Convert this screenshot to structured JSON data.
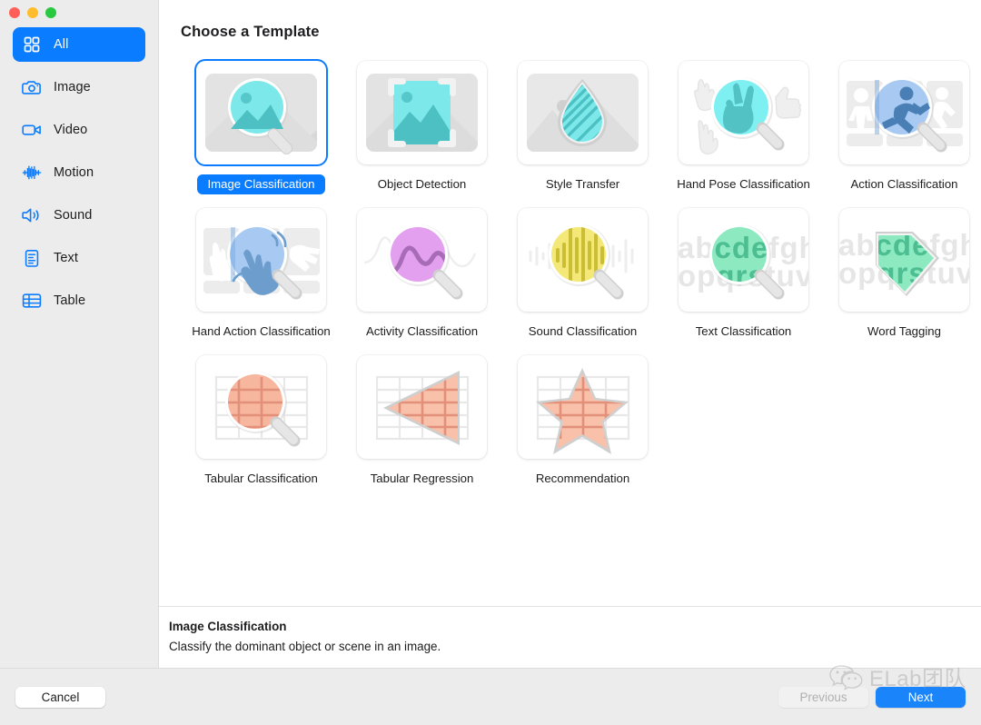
{
  "window": {
    "traffic_lights": [
      {
        "name": "close",
        "color": "#ff5f57"
      },
      {
        "name": "minimize",
        "color": "#febc2e"
      },
      {
        "name": "zoom",
        "color": "#28c840"
      }
    ]
  },
  "sidebar": {
    "items": [
      {
        "label": "All",
        "icon": "grid-icon",
        "selected": true
      },
      {
        "label": "Image",
        "icon": "camera-icon",
        "selected": false
      },
      {
        "label": "Video",
        "icon": "video-camera-icon",
        "selected": false
      },
      {
        "label": "Motion",
        "icon": "waveform-icon",
        "selected": false
      },
      {
        "label": "Sound",
        "icon": "speaker-icon",
        "selected": false
      },
      {
        "label": "Text",
        "icon": "document-icon",
        "selected": false
      },
      {
        "label": "Table",
        "icon": "table-icon",
        "selected": false
      }
    ],
    "accent": "#0a7cff"
  },
  "main": {
    "title": "Choose a Template",
    "templates": [
      {
        "label": "Image Classification",
        "icon": "image-magnifier-icon",
        "selected": true
      },
      {
        "label": "Object Detection",
        "icon": "image-brackets-icon",
        "selected": false
      },
      {
        "label": "Style Transfer",
        "icon": "droplet-icon",
        "selected": false
      },
      {
        "label": "Hand Pose Classification",
        "icon": "hand-peace-magnifier-icon",
        "selected": false
      },
      {
        "label": "Action Classification",
        "icon": "runner-magnifier-icon",
        "selected": false
      },
      {
        "label": "Hand Action Classification",
        "icon": "waving-hand-magnifier-icon",
        "selected": false
      },
      {
        "label": "Activity Classification",
        "icon": "wave-magnifier-icon",
        "selected": false
      },
      {
        "label": "Sound Classification",
        "icon": "audio-magnifier-icon",
        "selected": false
      },
      {
        "label": "Text Classification",
        "icon": "letters-magnifier-icon",
        "selected": false
      },
      {
        "label": "Word Tagging",
        "icon": "tag-letters-icon",
        "selected": false
      },
      {
        "label": "Tabular Classification",
        "icon": "table-magnifier-icon",
        "selected": false
      },
      {
        "label": "Tabular Regression",
        "icon": "table-triangle-icon",
        "selected": false
      },
      {
        "label": "Recommendation",
        "icon": "table-star-icon",
        "selected": false
      }
    ]
  },
  "description": {
    "title": "Image Classification",
    "text": "Classify the dominant object or scene in an image."
  },
  "footer": {
    "cancel_label": "Cancel",
    "previous_label": "Previous",
    "next_label": "Next",
    "next_color": "#1a84fb"
  },
  "watermark": {
    "text": "ELab团队",
    "icon": "wechat-icon"
  }
}
